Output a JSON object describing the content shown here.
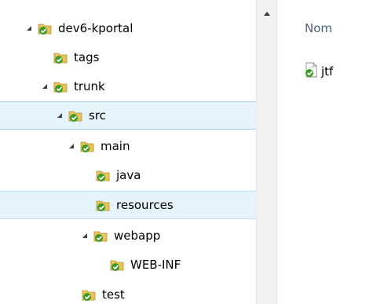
{
  "tree": {
    "items": [
      {
        "label": "dev6-kportal",
        "expanded": true
      },
      {
        "label": "tags",
        "expanded": false
      },
      {
        "label": "trunk",
        "expanded": true
      },
      {
        "label": "src",
        "expanded": true,
        "state": "selected"
      },
      {
        "label": "main",
        "expanded": true
      },
      {
        "label": "java",
        "expanded": false
      },
      {
        "label": "resources",
        "expanded": false,
        "state": "highlighted"
      },
      {
        "label": "webapp",
        "expanded": true
      },
      {
        "label": "WEB-INF",
        "expanded": false
      },
      {
        "label": "test",
        "expanded": false
      }
    ]
  },
  "content": {
    "column_header": "Nom",
    "files": [
      {
        "name": "jtf",
        "icon": "svn-file-icon"
      }
    ]
  },
  "icons": {
    "folder": "svn-folder-icon",
    "expand": "expanded-triangle-icon",
    "scroll_up": "scroll-up-arrow-icon"
  },
  "colors": {
    "selection_bg": "#e5f3fb",
    "selection_border": "#a6d2ee",
    "header_text": "#4c607a",
    "svn_check": "#3a9a24",
    "folder": "#e8c35a"
  }
}
